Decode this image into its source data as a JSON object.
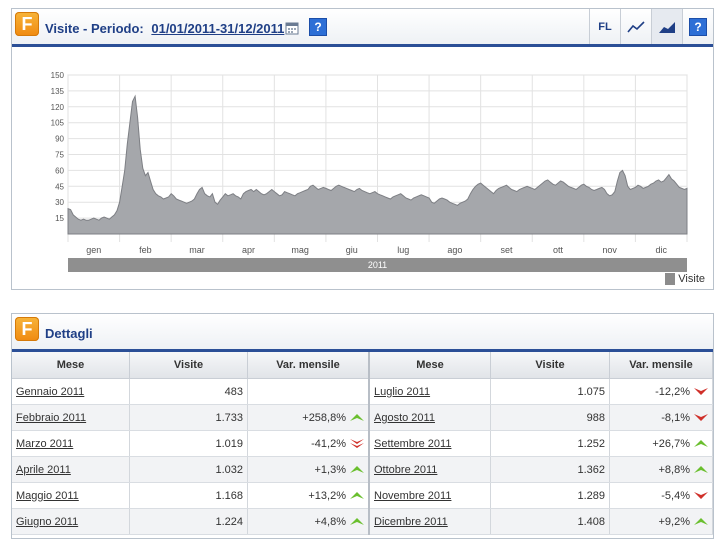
{
  "visite_panel": {
    "title_prefix": "Visite - Periodo:",
    "period": "01/01/2011-31/12/2011",
    "help_symbol": "?",
    "fl_label": "FL",
    "icons": [
      "calendar-icon",
      "help-icon",
      "line-chart-icon",
      "area-chart-icon"
    ]
  },
  "chart_data": {
    "type": "area",
    "ylim": [
      0,
      150
    ],
    "yticks": [
      "15",
      "30",
      "45",
      "60",
      "75",
      "90",
      "105",
      "120",
      "135",
      "150"
    ],
    "xlabels": [
      "gen",
      "feb",
      "mar",
      "apr",
      "mag",
      "giu",
      "lug",
      "ago",
      "set",
      "ott",
      "nov",
      "dic"
    ],
    "year_label": "2011",
    "legend": "Visite",
    "series_color": "#a5a7ab",
    "grid": true,
    "series": [
      {
        "name": "Visite",
        "values": [
          24,
          23,
          18,
          16,
          14,
          13,
          14,
          13,
          13,
          14,
          15,
          14,
          13,
          15,
          16,
          15,
          14,
          16,
          18,
          22,
          30,
          45,
          60,
          85,
          105,
          125,
          130,
          110,
          80,
          62,
          55,
          58,
          50,
          42,
          38,
          36,
          35,
          33,
          34,
          35,
          38,
          36,
          33,
          32,
          31,
          30,
          29,
          30,
          31,
          33,
          38,
          42,
          44,
          38,
          36,
          35,
          38,
          30,
          28,
          32,
          35,
          38,
          36,
          37,
          38,
          36,
          35,
          33,
          38,
          40,
          41,
          42,
          40,
          42,
          40,
          38,
          37,
          38,
          40,
          42,
          40,
          38,
          36,
          37,
          40,
          39,
          38,
          37,
          36,
          38,
          39,
          40,
          41,
          42,
          45,
          46,
          44,
          42,
          43,
          44,
          43,
          42,
          41,
          43,
          45,
          46,
          45,
          44,
          43,
          42,
          41,
          40,
          42,
          43,
          41,
          40,
          39,
          38,
          39,
          40,
          38,
          37,
          36,
          35,
          34,
          33,
          35,
          36,
          37,
          38,
          36,
          34,
          33,
          32,
          34,
          35,
          36,
          37,
          36,
          35,
          34,
          30,
          29,
          31,
          33,
          34,
          33,
          32,
          30,
          29,
          28,
          27,
          29,
          30,
          31,
          33,
          38,
          42,
          45,
          47,
          48,
          46,
          44,
          42,
          40,
          38,
          41,
          43,
          44,
          45,
          46,
          44,
          42,
          41,
          40,
          42,
          43,
          44,
          45,
          44,
          43,
          42,
          44,
          46,
          48,
          50,
          51,
          49,
          47,
          46,
          48,
          50,
          49,
          47,
          45,
          44,
          43,
          42,
          44,
          46,
          47,
          45,
          44,
          42,
          41,
          42,
          43,
          44,
          42,
          38,
          36,
          37,
          40,
          50,
          58,
          60,
          55,
          45,
          42,
          43,
          44,
          46,
          45,
          43,
          44,
          45,
          47,
          48,
          50,
          51,
          49,
          50,
          53,
          56,
          52,
          50,
          47,
          44,
          43,
          42,
          43
        ]
      }
    ]
  },
  "dettagli_panel": {
    "title": "Dettagli",
    "columns": [
      "Mese",
      "Visite",
      "Var. mensile",
      "Mese",
      "Visite",
      "Var. mensile"
    ],
    "rows": [
      {
        "left": {
          "month": "Gennaio 2011",
          "visits": "483",
          "var": "",
          "trend": ""
        },
        "right": {
          "month": "Luglio 2011",
          "visits": "1.075",
          "var": "-12,2%",
          "trend": "down"
        }
      },
      {
        "left": {
          "month": "Febbraio 2011",
          "visits": "1.733",
          "var": "+258,8%",
          "trend": "up"
        },
        "right": {
          "month": "Agosto 2011",
          "visits": "988",
          "var": "-8,1%",
          "trend": "down"
        }
      },
      {
        "left": {
          "month": "Marzo 2011",
          "visits": "1.019",
          "var": "-41,2%",
          "trend": "down-double"
        },
        "right": {
          "month": "Settembre 2011",
          "visits": "1.252",
          "var": "+26,7%",
          "trend": "up"
        }
      },
      {
        "left": {
          "month": "Aprile 2011",
          "visits": "1.032",
          "var": "+1,3%",
          "trend": "up"
        },
        "right": {
          "month": "Ottobre 2011",
          "visits": "1.362",
          "var": "+8,8%",
          "trend": "up"
        }
      },
      {
        "left": {
          "month": "Maggio 2011",
          "visits": "1.168",
          "var": "+13,2%",
          "trend": "up"
        },
        "right": {
          "month": "Novembre 2011",
          "visits": "1.289",
          "var": "-5,4%",
          "trend": "down"
        }
      },
      {
        "left": {
          "month": "Giugno 2011",
          "visits": "1.224",
          "var": "+4,8%",
          "trend": "up"
        },
        "right": {
          "month": "Dicembre 2011",
          "visits": "1.408",
          "var": "+9,2%",
          "trend": "up"
        }
      }
    ],
    "colors": {
      "up": "#6abf2e",
      "down": "#d0302a"
    }
  }
}
